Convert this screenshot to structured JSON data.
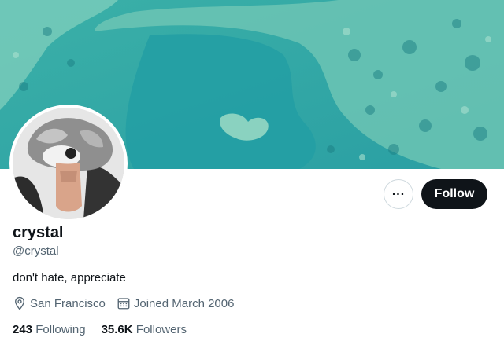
{
  "profile": {
    "display_name": "crystal",
    "handle": "@crystal",
    "bio": "don't hate, appreciate",
    "location": "San Francisco",
    "joined": "Joined March 2006",
    "following_count": "243",
    "following_label": "Following",
    "followers_count": "35.6K",
    "followers_label": "Followers"
  },
  "actions": {
    "more_label": "...",
    "follow_label": "Follow"
  },
  "icons": {
    "more": "more-icon",
    "location": "location-pin-icon",
    "calendar": "calendar-icon"
  },
  "colors": {
    "follow_button": "#0f1419",
    "secondary_text": "#536471",
    "reef_water": "#2fa9a6"
  }
}
